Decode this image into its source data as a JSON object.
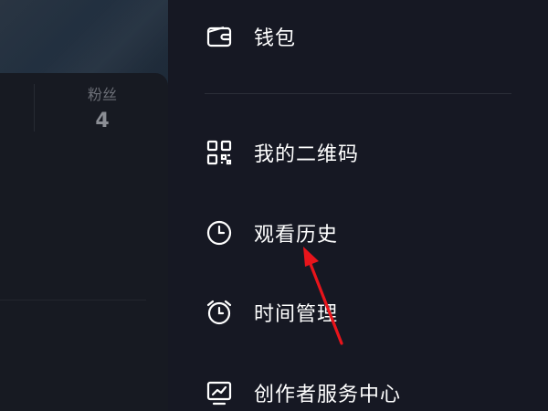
{
  "profile": {
    "fans_label": "粉丝",
    "fans_count": "4"
  },
  "drawer": {
    "items": [
      {
        "label": "钱包",
        "icon": "wallet-icon"
      },
      {
        "label": "我的二维码",
        "icon": "qrcode-icon"
      },
      {
        "label": "观看历史",
        "icon": "clock-icon"
      },
      {
        "label": "时间管理",
        "icon": "alarm-clock-icon"
      },
      {
        "label": "创作者服务中心",
        "icon": "creator-chart-icon"
      }
    ]
  },
  "colors": {
    "background": "#161823",
    "text": "#ffffff",
    "annotation": "#e8141b"
  }
}
